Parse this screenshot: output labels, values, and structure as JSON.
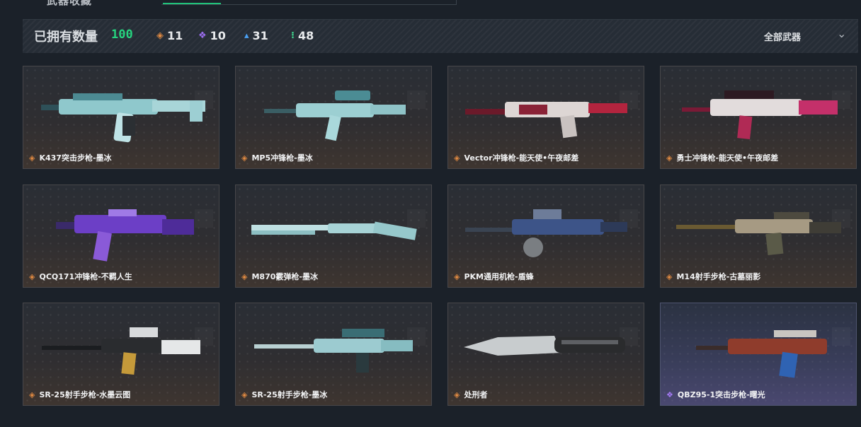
{
  "header": {
    "title": "武器收藏"
  },
  "summary": {
    "owned_label": "已拥有数量",
    "owned_count": "100",
    "rarities": [
      {
        "icon": "orange-diamond-icon",
        "glyph": "◈",
        "count": "11",
        "color": "#e08a42"
      },
      {
        "icon": "purple-diamond-icon",
        "glyph": "❖",
        "count": "10",
        "color": "#9c6ef0"
      },
      {
        "icon": "blue-triangle-icon",
        "glyph": "▴",
        "count": "31",
        "color": "#4aa0f2"
      },
      {
        "icon": "green-dot-icon",
        "glyph": "⁝",
        "count": "48",
        "color": "#3fd28c"
      }
    ],
    "filter_value": "全部武器"
  },
  "weapons": [
    {
      "name": "K437突击步枪-墨冰",
      "rarity": "orange"
    },
    {
      "name": "MP5冲锋枪-墨冰",
      "rarity": "orange"
    },
    {
      "name": "Vector冲锋枪-能天使•午夜邮差",
      "rarity": "orange"
    },
    {
      "name": "勇士冲锋枪-能天使•午夜邮差",
      "rarity": "orange"
    },
    {
      "name": "QCQ171冲锋枪-不羁人生",
      "rarity": "orange"
    },
    {
      "name": "M870霰弹枪-墨冰",
      "rarity": "orange"
    },
    {
      "name": "PKM通用机枪-盾蜂",
      "rarity": "orange"
    },
    {
      "name": "M14射手步枪-古墓丽影",
      "rarity": "orange"
    },
    {
      "name": "SR-25射手步枪-水墨云图",
      "rarity": "orange"
    },
    {
      "name": "SR-25射手步枪-墨冰",
      "rarity": "orange"
    },
    {
      "name": "处刑者",
      "rarity": "orange"
    },
    {
      "name": "QBZ95-1突击步枪-曙光",
      "rarity": "purple"
    }
  ],
  "colors": {
    "accent_green": "#21c27a",
    "count_green": "#26d47f",
    "orange": "#e08a42",
    "purple": "#9c6ef0"
  }
}
